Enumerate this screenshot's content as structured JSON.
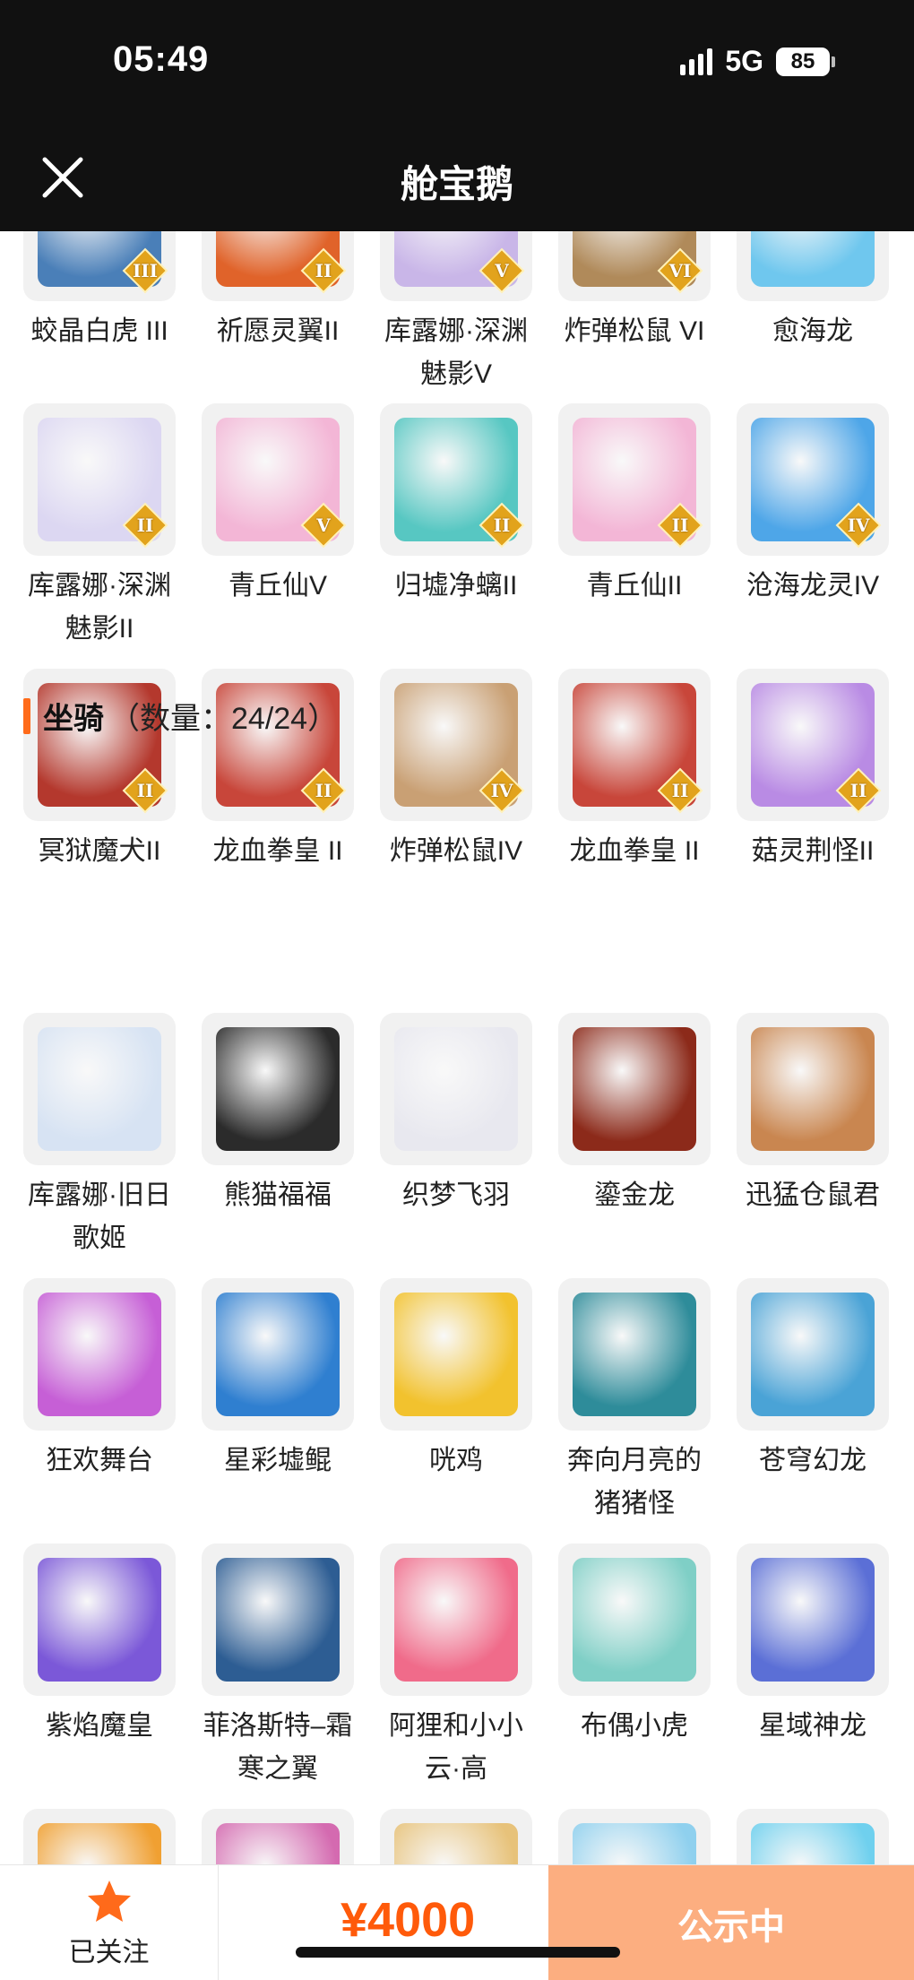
{
  "status_bar": {
    "time": "05:49",
    "network": "5G",
    "battery": "85"
  },
  "header": {
    "title": "舱宝鹅"
  },
  "pets_partial": [
    {
      "name": "蛟晶白虎 III",
      "rank": "III",
      "color": "#4a7fb8",
      "icon": "tiger-icon"
    },
    {
      "name": "祈愿灵翼II",
      "rank": "II",
      "color": "#e0632a",
      "icon": "wing-icon"
    },
    {
      "name": "库露娜·深渊魅影V",
      "rank": "V",
      "color": "#c9b6e8",
      "icon": "girl-icon"
    },
    {
      "name": "炸弹松鼠 VI",
      "rank": "VI",
      "color": "#b08a5a",
      "icon": "squirrel-icon"
    },
    {
      "name": "愈海龙",
      "rank": "",
      "color": "#6fc7ee",
      "icon": "dragon-icon"
    }
  ],
  "pets_row2": [
    {
      "name": "库露娜·深渊魅影II",
      "rank": "II",
      "color": "#dcd7f2",
      "icon": "girl-icon"
    },
    {
      "name": "青丘仙V",
      "rank": "V",
      "color": "#f3b6d6",
      "icon": "fox-girl-icon"
    },
    {
      "name": "归墟净螭II",
      "rank": "II",
      "color": "#57c7c2",
      "icon": "dragon-icon"
    },
    {
      "name": "青丘仙II",
      "rank": "II",
      "color": "#f3b6d6",
      "icon": "fox-girl-icon"
    },
    {
      "name": "沧海龙灵IV",
      "rank": "IV",
      "color": "#4ea6e8",
      "icon": "dragon-boy-icon"
    }
  ],
  "pets_row3": [
    {
      "name": "冥狱魔犬II",
      "rank": "II",
      "color": "#b4382d",
      "icon": "hound-icon"
    },
    {
      "name": "龙血拳皇 II",
      "rank": "II",
      "color": "#c8463a",
      "icon": "ram-icon"
    },
    {
      "name": "炸弹松鼠IV",
      "rank": "IV",
      "color": "#c9a074",
      "icon": "squirrel-icon"
    },
    {
      "name": "龙血拳皇 II",
      "rank": "II",
      "color": "#c8463a",
      "icon": "ram-icon"
    },
    {
      "name": "菇灵荆怪II",
      "rank": "II",
      "color": "#b98be4",
      "icon": "mushroom-icon"
    }
  ],
  "mounts_section": {
    "title": "坐骑",
    "count": "（数量：24/24）"
  },
  "mounts_row1": [
    {
      "name": "库露娜·旧日歌姬",
      "color": "#d7e3f3",
      "icon": "girl-icon"
    },
    {
      "name": "熊猫福福",
      "color": "#2b2b2b",
      "icon": "panda-icon"
    },
    {
      "name": "织梦飞羽",
      "color": "#e8e8ef",
      "icon": "feather-icon"
    },
    {
      "name": "鎏金龙",
      "color": "#8c2a1a",
      "icon": "dragon-icon"
    },
    {
      "name": "迅猛仓鼠君",
      "color": "#c98650",
      "icon": "hamster-icon"
    }
  ],
  "mounts_row2": [
    {
      "name": "狂欢舞台",
      "color": "#c65fd6",
      "icon": "heart-icon"
    },
    {
      "name": "星彩墟鲲",
      "color": "#2f7fd0",
      "icon": "whale-icon"
    },
    {
      "name": "咣鸡",
      "color": "#f2c22e",
      "icon": "chicken-icon"
    },
    {
      "name": "奔向月亮的猪猪怪",
      "color": "#2e8c9a",
      "icon": "pig-icon"
    },
    {
      "name": "苍穹幻龙",
      "color": "#4aa3d6",
      "icon": "dragon-icon"
    }
  ],
  "mounts_row3": [
    {
      "name": "紫焰魔皇",
      "color": "#7b58d8",
      "icon": "phoenix-icon"
    },
    {
      "name": "菲洛斯特–霜寒之翼",
      "color": "#2d5d93",
      "icon": "ice-wing-icon"
    },
    {
      "name": "阿狸和小小云·高",
      "color": "#f06b8a",
      "icon": "fox-icon"
    },
    {
      "name": "布偶小虎",
      "color": "#7fcfc6",
      "icon": "tiger-doll-icon"
    },
    {
      "name": "星域神龙",
      "color": "#5b6fd6",
      "icon": "dragon-icon"
    }
  ],
  "mounts_row4_partial": [
    {
      "color": "#f0a032"
    },
    {
      "color": "#d46ab0"
    },
    {
      "color": "#e7c27a"
    },
    {
      "color": "#8fd0ee"
    },
    {
      "color": "#6fd0ee"
    }
  ],
  "bottom_bar": {
    "follow_label": "已关注",
    "price": "¥4000",
    "status_button": "公示中"
  }
}
